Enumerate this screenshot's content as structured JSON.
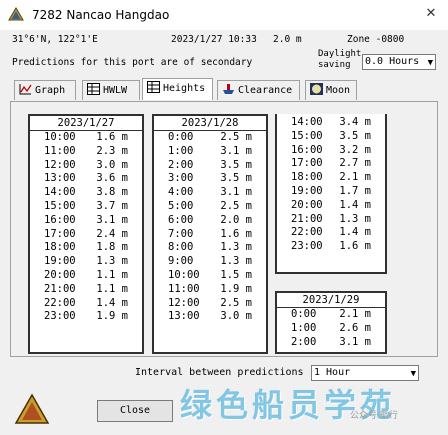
{
  "window": {
    "title": "7282  Nancao Hangdao",
    "close_glyph": "✕"
  },
  "info": {
    "position": "31°6'N, 122°1'E",
    "datetime": "2023/1/27 10:33",
    "height": "2.0 m",
    "zone": "Zone -0800",
    "note": "Predictions for this port are of secondary",
    "daylight_label_1": "Daylight",
    "daylight_label_2": "saving",
    "daylight_value": "0.0 Hours"
  },
  "tabs": [
    {
      "label": "Graph",
      "icon": "graph-icon"
    },
    {
      "label": "HWLW",
      "icon": "table-icon"
    },
    {
      "label": "Heights",
      "icon": "table-icon"
    },
    {
      "label": "Clearance",
      "icon": "ship-icon"
    },
    {
      "label": "Moon",
      "icon": "moon-icon"
    }
  ],
  "heights": {
    "day1": {
      "date": "2023/1/27",
      "rows": [
        {
          "time": "10:00",
          "value": "1.6 m"
        },
        {
          "time": "11:00",
          "value": "2.3 m"
        },
        {
          "time": "12:00",
          "value": "3.0 m"
        },
        {
          "time": "13:00",
          "value": "3.6 m"
        },
        {
          "time": "14:00",
          "value": "3.8 m"
        },
        {
          "time": "15:00",
          "value": "3.7 m"
        },
        {
          "time": "16:00",
          "value": "3.1 m"
        },
        {
          "time": "17:00",
          "value": "2.4 m"
        },
        {
          "time": "18:00",
          "value": "1.8 m"
        },
        {
          "time": "19:00",
          "value": "1.3 m"
        },
        {
          "time": "20:00",
          "value": "1.1 m"
        },
        {
          "time": "21:00",
          "value": "1.1 m"
        },
        {
          "time": "22:00",
          "value": "1.4 m"
        },
        {
          "time": "23:00",
          "value": "1.9 m"
        }
      ]
    },
    "day2": {
      "date": "2023/1/28",
      "rows": [
        {
          "time": "0:00",
          "value": "2.5 m"
        },
        {
          "time": "1:00",
          "value": "3.1 m"
        },
        {
          "time": "2:00",
          "value": "3.5 m"
        },
        {
          "time": "3:00",
          "value": "3.5 m"
        },
        {
          "time": "4:00",
          "value": "3.1 m"
        },
        {
          "time": "5:00",
          "value": "2.5 m"
        },
        {
          "time": "6:00",
          "value": "2.0 m"
        },
        {
          "time": "7:00",
          "value": "1.6 m"
        },
        {
          "time": "8:00",
          "value": "1.3 m"
        },
        {
          "time": "9:00",
          "value": "1.3 m"
        },
        {
          "time": "10:00",
          "value": "1.5 m"
        },
        {
          "time": "11:00",
          "value": "1.9 m"
        },
        {
          "time": "12:00",
          "value": "2.5 m"
        },
        {
          "time": "13:00",
          "value": "3.0 m"
        }
      ]
    },
    "day2_cont": {
      "rows": [
        {
          "time": "14:00",
          "value": "3.4 m"
        },
        {
          "time": "15:00",
          "value": "3.5 m"
        },
        {
          "time": "16:00",
          "value": "3.2 m"
        },
        {
          "time": "17:00",
          "value": "2.7 m"
        },
        {
          "time": "18:00",
          "value": "2.1 m"
        },
        {
          "time": "19:00",
          "value": "1.7 m"
        },
        {
          "time": "20:00",
          "value": "1.4 m"
        },
        {
          "time": "21:00",
          "value": "1.3 m"
        },
        {
          "time": "22:00",
          "value": "1.4 m"
        },
        {
          "time": "23:00",
          "value": "1.6 m"
        }
      ]
    },
    "day3": {
      "date": "2023/1/29",
      "rows": [
        {
          "time": "0:00",
          "value": "2.1 m"
        },
        {
          "time": "1:00",
          "value": "2.6 m"
        },
        {
          "time": "2:00",
          "value": "3.1 m"
        }
      ]
    }
  },
  "interval": {
    "label": "Interval between predictions",
    "value": "1 Hour"
  },
  "buttons": {
    "close": "Close"
  },
  "watermark": {
    "text": "绿色船员学苑",
    "small": "公众号·航行"
  }
}
